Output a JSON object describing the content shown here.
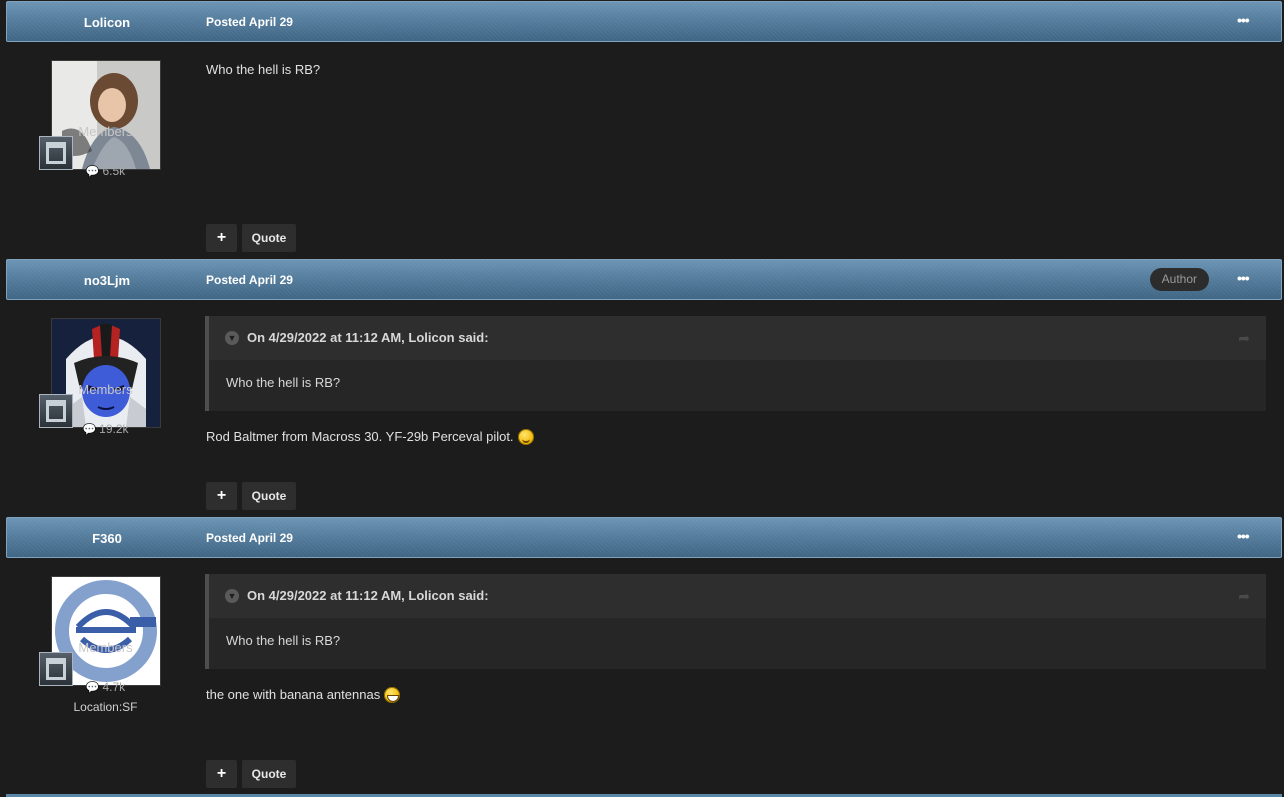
{
  "posts": [
    {
      "author": "Lolicon",
      "posted": "Posted April 29",
      "group": "Members",
      "count": "6.5k",
      "content": "Who the hell is RB?",
      "plus_label": "+",
      "quote_label": "Quote"
    },
    {
      "author": "no3Ljm",
      "posted": "Posted April 29",
      "badge": "Author",
      "group": "Members",
      "count": "19.2k",
      "quote": {
        "citation": "On 4/29/2022 at 11:12 AM, Lolicon said:",
        "body": "Who the hell is RB?"
      },
      "content": "Rod Baltmer from Macross 30. YF-29b Perceval pilot.",
      "emoji": "wink-emoji",
      "plus_label": "+",
      "quote_label": "Quote"
    },
    {
      "author": "F360",
      "posted": "Posted April 29",
      "group": "Members",
      "count": "4.7k",
      "location": "Location:SF",
      "quote": {
        "citation": "On 4/29/2022 at 11:12 AM, Lolicon said:",
        "body": "Who the hell is RB?"
      },
      "content": "the one with banana antennas",
      "emoji": "grin-emoji",
      "plus_label": "+",
      "quote_label": "Quote"
    }
  ],
  "icons": {
    "menu": "ellipsis-icon",
    "comment": "comment-bubble-icon",
    "collapse": "chevron-down-icon",
    "share": "share-arrow-icon",
    "rank": "rank-badge-icon"
  },
  "colors": {
    "header_gradient_top": "#6b93b3",
    "header_gradient_bottom": "#3f6584",
    "page_background": "#1c1c1c",
    "button_background": "#2e2e2e"
  }
}
